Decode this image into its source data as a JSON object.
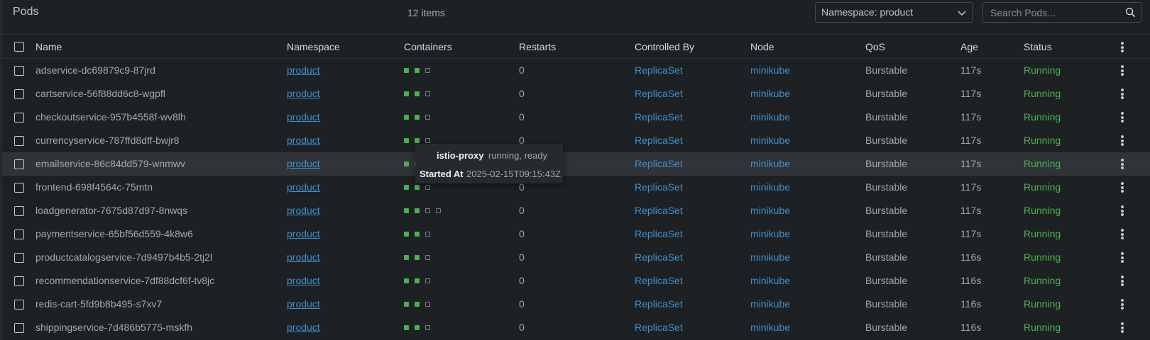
{
  "header": {
    "title": "Pods",
    "item_count": "12 items",
    "namespace_select": "Namespace: product",
    "search_placeholder": "Search Pods..."
  },
  "columns": {
    "name": "Name",
    "namespace": "Namespace",
    "containers": "Containers",
    "restarts": "Restarts",
    "controlled_by": "Controlled By",
    "node": "Node",
    "qos": "QoS",
    "age": "Age",
    "status": "Status"
  },
  "colors": {
    "link": "#3d90ce",
    "running": "#4caf50",
    "container_ready": "#4caf50",
    "row_hover": "#303338"
  },
  "rows": [
    {
      "name": "adservice-dc69879c9-87jrd",
      "namespace": "product",
      "containers": [
        "ready",
        "ready",
        "init"
      ],
      "restarts": "0",
      "controlled_by": "ReplicaSet",
      "node": "minikube",
      "qos": "Burstable",
      "age": "117s",
      "status": "Running"
    },
    {
      "name": "cartservice-56f88dd6c8-wgpfl",
      "namespace": "product",
      "containers": [
        "ready",
        "ready",
        "init"
      ],
      "restarts": "0",
      "controlled_by": "ReplicaSet",
      "node": "minikube",
      "qos": "Burstable",
      "age": "117s",
      "status": "Running"
    },
    {
      "name": "checkoutservice-957b4558f-wv8lh",
      "namespace": "product",
      "containers": [
        "ready",
        "ready",
        "init"
      ],
      "restarts": "0",
      "controlled_by": "ReplicaSet",
      "node": "minikube",
      "qos": "Burstable",
      "age": "117s",
      "status": "Running"
    },
    {
      "name": "currencyservice-787ffd8dff-bwjr8",
      "namespace": "product",
      "containers": [
        "ready",
        "ready",
        "init"
      ],
      "restarts": "0",
      "controlled_by": "ReplicaSet",
      "node": "minikube",
      "qos": "Burstable",
      "age": "117s",
      "status": "Running"
    },
    {
      "name": "emailservice-86c84dd579-wnmwv",
      "namespace": "product",
      "containers": [
        "ready",
        "ready",
        "init"
      ],
      "restarts": "0",
      "controlled_by": "ReplicaSet",
      "node": "minikube",
      "qos": "Burstable",
      "age": "117s",
      "status": "Running",
      "hovered": true
    },
    {
      "name": "frontend-698f4564c-75mtn",
      "namespace": "product",
      "containers": [
        "ready",
        "ready",
        "init"
      ],
      "restarts": "0",
      "controlled_by": "ReplicaSet",
      "node": "minikube",
      "qos": "Burstable",
      "age": "117s",
      "status": "Running"
    },
    {
      "name": "loadgenerator-7675d87d97-8nwqs",
      "namespace": "product",
      "containers": [
        "ready",
        "ready",
        "init",
        "init"
      ],
      "restarts": "0",
      "controlled_by": "ReplicaSet",
      "node": "minikube",
      "qos": "Burstable",
      "age": "117s",
      "status": "Running"
    },
    {
      "name": "paymentservice-65bf56d559-4k8w6",
      "namespace": "product",
      "containers": [
        "ready",
        "ready",
        "init"
      ],
      "restarts": "0",
      "controlled_by": "ReplicaSet",
      "node": "minikube",
      "qos": "Burstable",
      "age": "117s",
      "status": "Running"
    },
    {
      "name": "productcatalogservice-7d9497b4b5-2tj2l",
      "namespace": "product",
      "containers": [
        "ready",
        "ready",
        "init"
      ],
      "restarts": "0",
      "controlled_by": "ReplicaSet",
      "node": "minikube",
      "qos": "Burstable",
      "age": "116s",
      "status": "Running"
    },
    {
      "name": "recommendationservice-7df88dcf6f-tv8jc",
      "namespace": "product",
      "containers": [
        "ready",
        "ready",
        "init"
      ],
      "restarts": "0",
      "controlled_by": "ReplicaSet",
      "node": "minikube",
      "qos": "Burstable",
      "age": "116s",
      "status": "Running"
    },
    {
      "name": "redis-cart-5fd9b8b495-s7xv7",
      "namespace": "product",
      "containers": [
        "ready",
        "ready",
        "init"
      ],
      "restarts": "0",
      "controlled_by": "ReplicaSet",
      "node": "minikube",
      "qos": "Burstable",
      "age": "116s",
      "status": "Running"
    },
    {
      "name": "shippingservice-7d486b5775-mskfh",
      "namespace": "product",
      "containers": [
        "ready",
        "ready",
        "init"
      ],
      "restarts": "0",
      "controlled_by": "ReplicaSet",
      "node": "minikube",
      "qos": "Burstable",
      "age": "116s",
      "status": "Running"
    }
  ],
  "tooltip": {
    "container_name": "istio-proxy",
    "container_state": "running, ready",
    "started_label": "Started At",
    "started_value": "2025-02-15T09:15:43Z"
  }
}
